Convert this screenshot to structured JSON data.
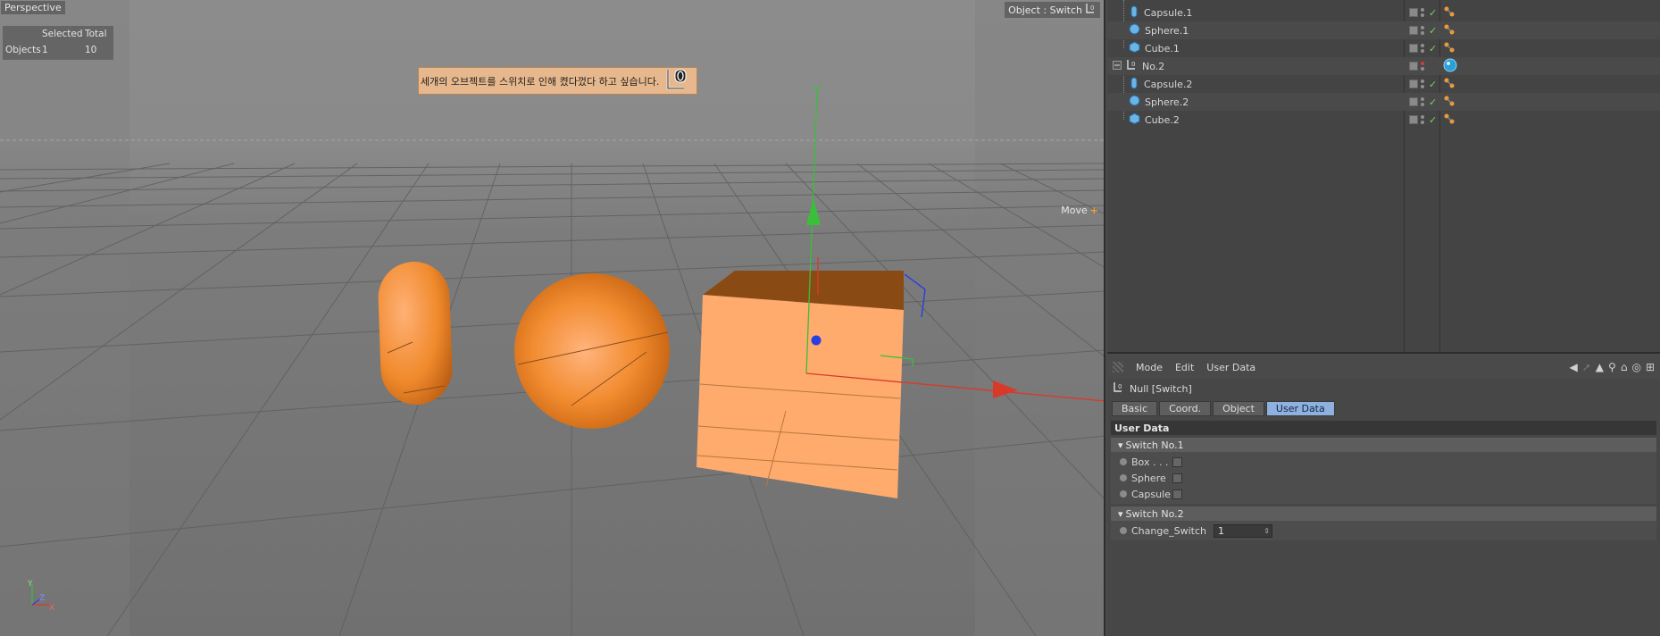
{
  "viewport": {
    "title": "Perspective",
    "object_label": "Object : Switch",
    "hud": {
      "headers": [
        "",
        "Selected",
        "Total"
      ],
      "row_label": "Objects",
      "selected": "1",
      "total": "10"
    },
    "note": "세개의 오브젝트를 스위치로 인해 켰다껐다 하고 싶습니다.",
    "tool_label": "Move",
    "axis_y": "Y",
    "axis_z": "Z",
    "axis_x": "X",
    "colors": {
      "object_orange": "#f08a2c",
      "axis_x": "#d83a2a",
      "axis_y": "#38c038",
      "axis_z": "#2a3fe0"
    }
  },
  "object_manager": {
    "items": [
      {
        "name": "Capsule.1",
        "icon": "capsule-icon"
      },
      {
        "name": "Sphere.1",
        "icon": "sphere-icon"
      },
      {
        "name": "Cube.1",
        "icon": "cube-icon"
      },
      {
        "name": "No.2",
        "icon": "null-icon"
      },
      {
        "name": "Capsule.2",
        "icon": "capsule-icon"
      },
      {
        "name": "Sphere.2",
        "icon": "sphere-icon"
      },
      {
        "name": "Cube.2",
        "icon": "cube-icon"
      }
    ]
  },
  "attribute_manager": {
    "menu": [
      "Mode",
      "Edit",
      "User Data"
    ],
    "object_title": "Null [Switch]",
    "tabs": [
      "Basic",
      "Coord.",
      "Object",
      "User Data"
    ],
    "active_tab": "User Data",
    "section_title": "User Data",
    "group1": {
      "title": "Switch No.1",
      "params": [
        "Box . . .",
        "Sphere",
        "Capsule"
      ]
    },
    "group2": {
      "title": "Switch No.2",
      "param_label": "Change_Switch",
      "param_value": "1"
    },
    "accent_color": "#8fb1df"
  }
}
